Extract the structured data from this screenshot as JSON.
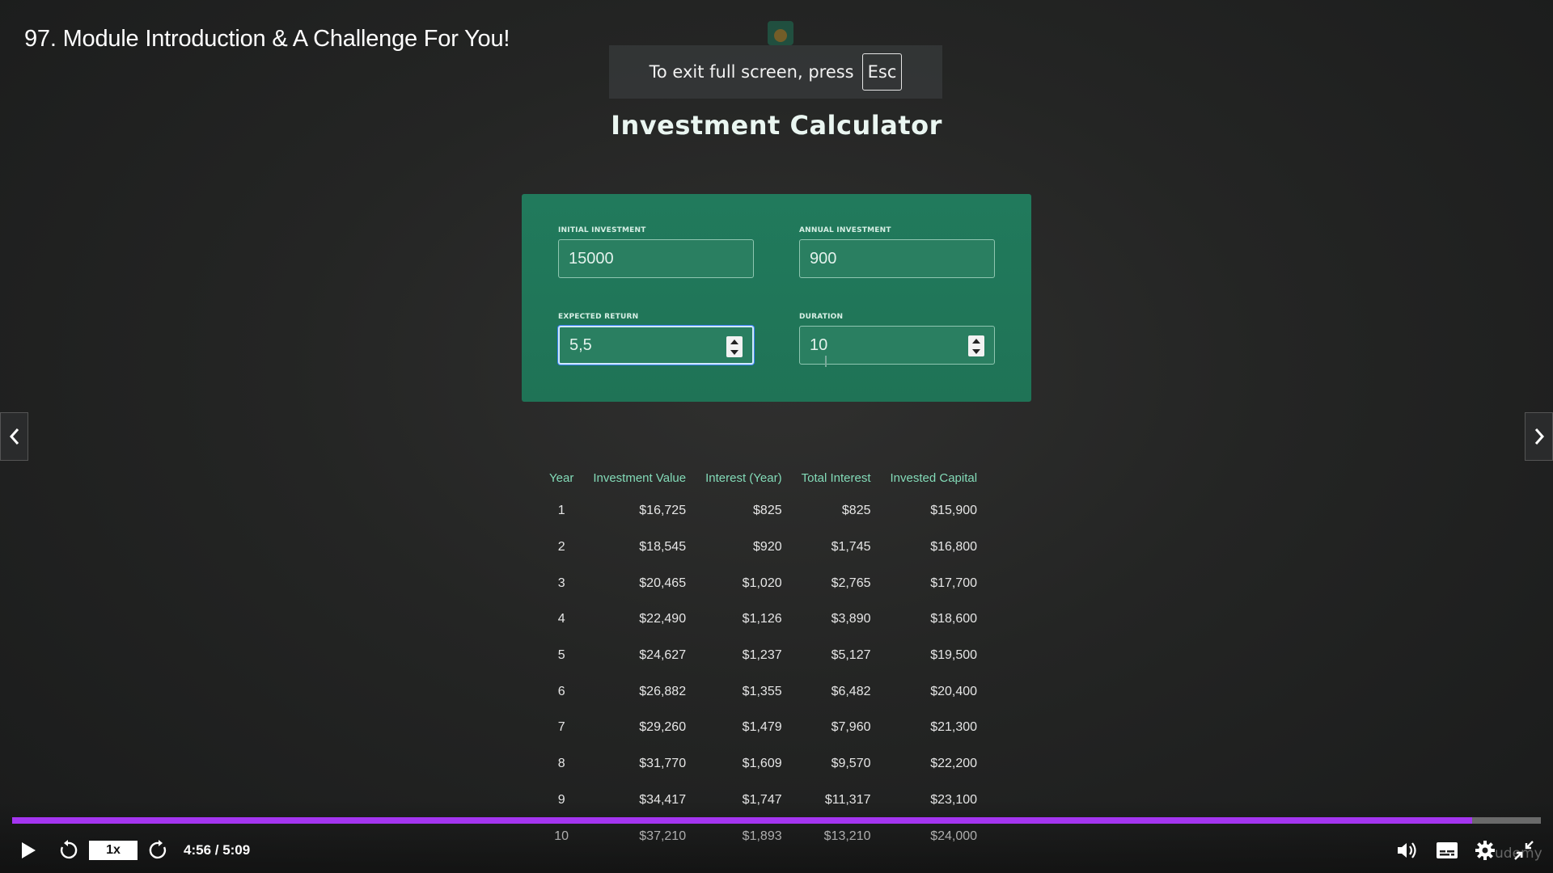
{
  "player": {
    "lecture_title": "97. Module Introduction & A Challenge For You!",
    "fullscreen_hint": "To exit full screen, press",
    "fullscreen_key": "Esc",
    "speed_label": "1x",
    "time_readout": "4:56 / 5:09",
    "progress_fraction": 0.955,
    "accent_color": "#a435f0",
    "brand_watermark": "udemy"
  },
  "app": {
    "title": "Investment Calculator",
    "card_color": "#217a5c",
    "inputs": {
      "initial_investment": {
        "label": "Initial Investment",
        "value": "15000"
      },
      "annual_investment": {
        "label": "Annual Investment",
        "value": "900"
      },
      "expected_return": {
        "label": "Expected Return",
        "value": "5,5"
      },
      "duration": {
        "label": "Duration",
        "value": "10"
      }
    },
    "table": {
      "headers": [
        "Year",
        "Investment Value",
        "Interest (Year)",
        "Total Interest",
        "Invested Capital"
      ],
      "rows": [
        [
          "1",
          "$16,725",
          "$825",
          "$825",
          "$15,900"
        ],
        [
          "2",
          "$18,545",
          "$920",
          "$1,745",
          "$16,800"
        ],
        [
          "3",
          "$20,465",
          "$1,020",
          "$2,765",
          "$17,700"
        ],
        [
          "4",
          "$22,490",
          "$1,126",
          "$3,890",
          "$18,600"
        ],
        [
          "5",
          "$24,627",
          "$1,237",
          "$5,127",
          "$19,500"
        ],
        [
          "6",
          "$26,882",
          "$1,355",
          "$6,482",
          "$20,400"
        ],
        [
          "7",
          "$29,260",
          "$1,479",
          "$7,960",
          "$21,300"
        ],
        [
          "8",
          "$31,770",
          "$1,609",
          "$9,570",
          "$22,200"
        ],
        [
          "9",
          "$34,417",
          "$1,747",
          "$11,317",
          "$23,100"
        ],
        [
          "10",
          "$37,210",
          "$1,893",
          "$13,210",
          "$24,000"
        ]
      ]
    }
  },
  "icons": {
    "prev": "chevron-left-icon",
    "next": "chevron-right-icon",
    "play": "play-icon",
    "rewind": "rewind-5-icon",
    "forward": "forward-5-icon",
    "volume": "volume-icon",
    "captions": "captions-icon",
    "settings": "gear-icon",
    "exit_fullscreen": "exit-fullscreen-icon"
  }
}
